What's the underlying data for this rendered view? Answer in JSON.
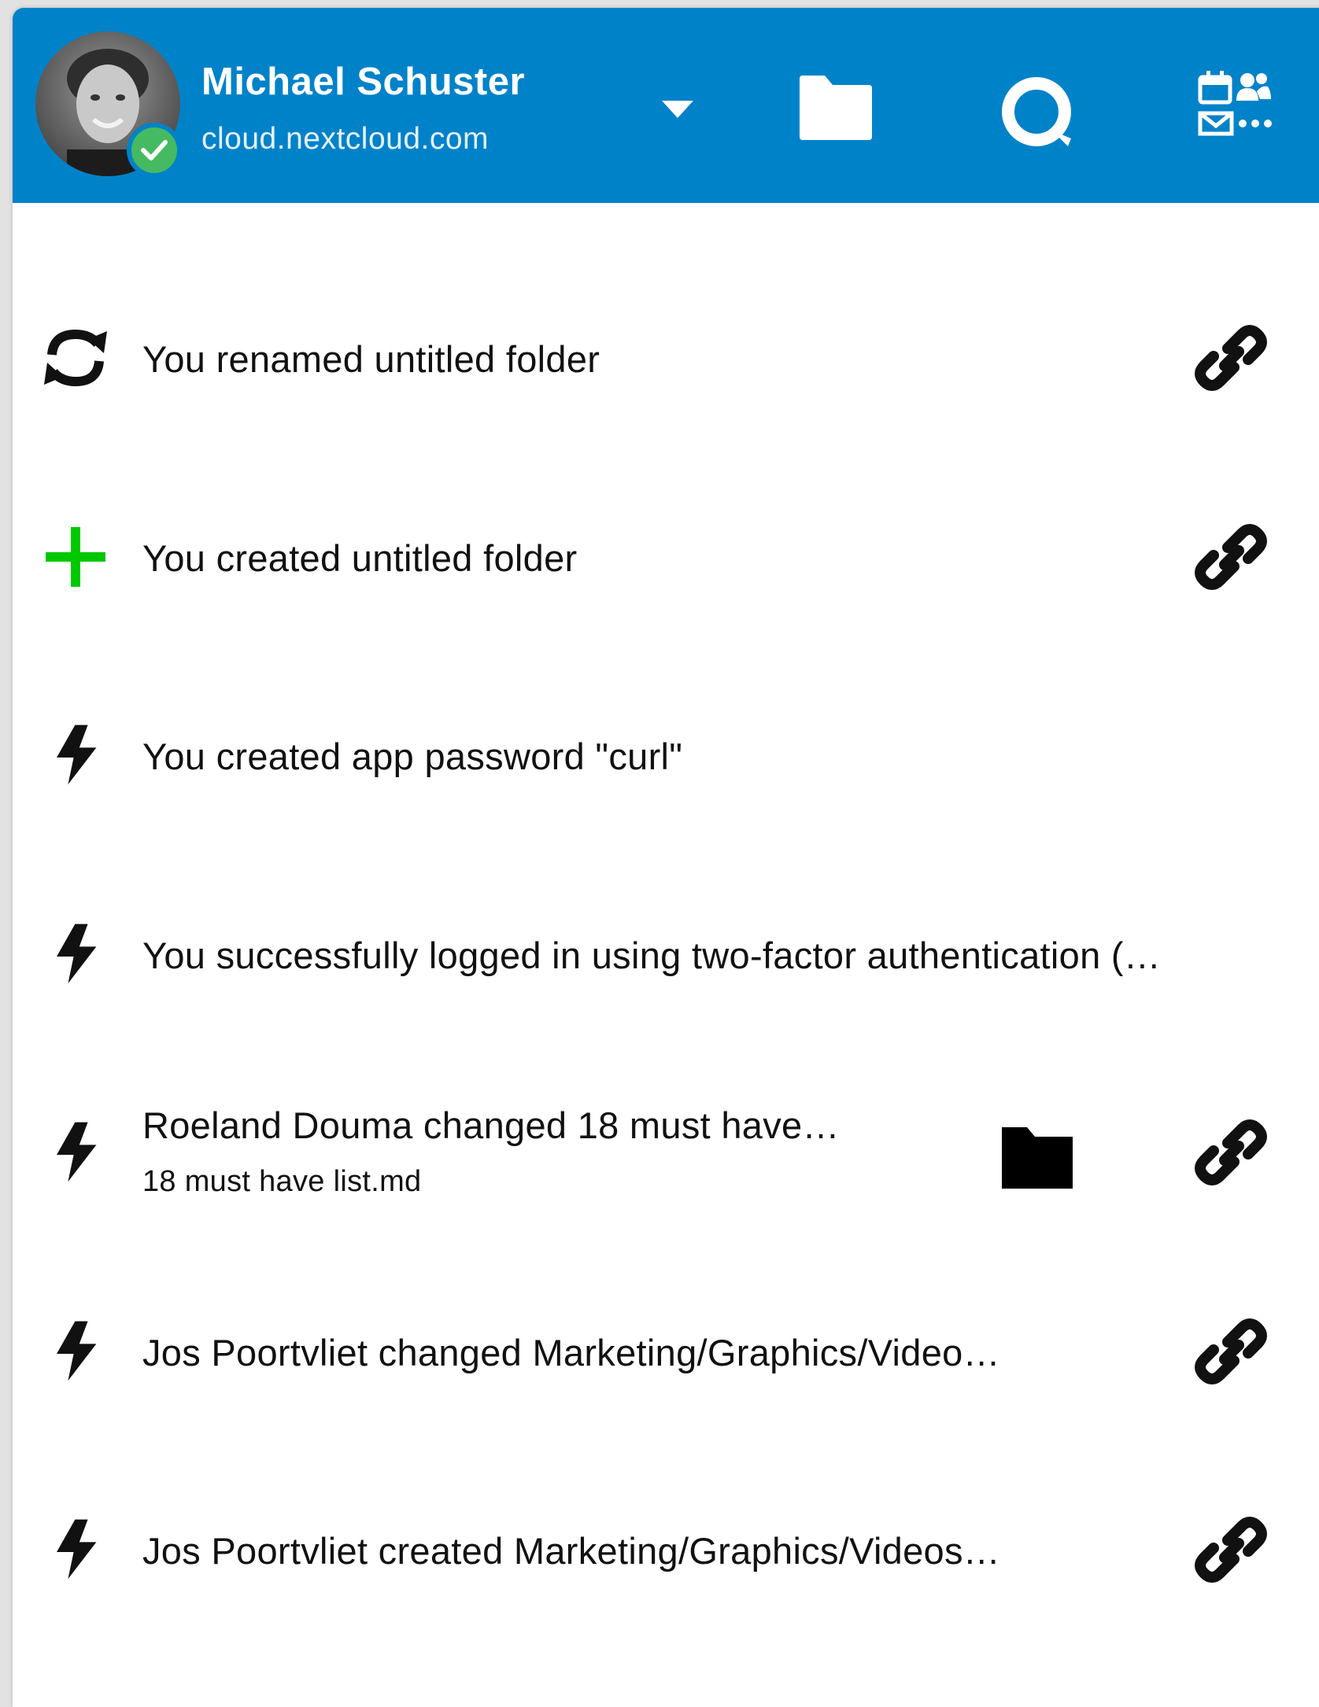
{
  "header": {
    "user_name": "Michael Schuster",
    "server": "cloud.nextcloud.com",
    "status": "online",
    "icons": {
      "dropdown": "caret-down-icon",
      "files": "folder-icon",
      "search": "search-icon",
      "apps": "apps-icon"
    },
    "colors": {
      "header_bg": "#0082c9",
      "status_online": "#46ba61",
      "create_green": "#00c800"
    }
  },
  "activities": [
    {
      "icon": "refresh-icon",
      "text": "You renamed untitled folder",
      "has_link": true
    },
    {
      "icon": "plus-icon",
      "text": "You created untitled folder",
      "has_link": true
    },
    {
      "icon": "lightning-icon",
      "text": "You created app password \"curl\"",
      "has_link": false
    },
    {
      "icon": "lightning-icon",
      "text": "You successfully logged in using two-factor authentication (…",
      "has_link": false
    },
    {
      "icon": "lightning-icon",
      "text": "Roeland Douma changed 18 must have…",
      "subtext": "18 must have list.md",
      "has_folder": true,
      "has_link": true
    },
    {
      "icon": "lightning-icon",
      "text": "Jos Poortvliet changed Marketing/Graphics/Video…",
      "has_link": true
    },
    {
      "icon": "lightning-icon",
      "text": "Jos Poortvliet created Marketing/Graphics/Videos…",
      "has_link": true
    }
  ]
}
